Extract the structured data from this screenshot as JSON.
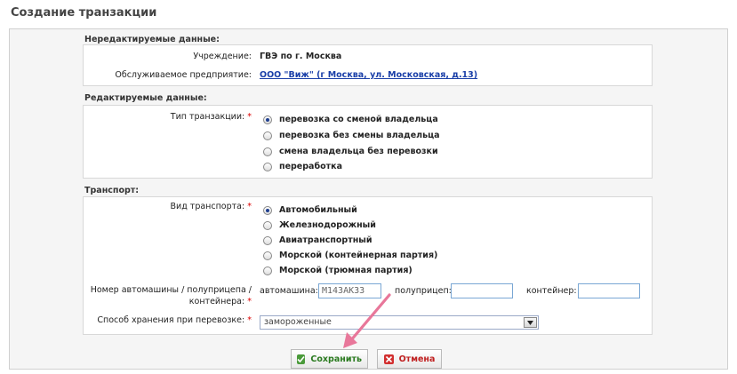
{
  "page": {
    "title": "Создание транзакции"
  },
  "readonly": {
    "section_title": "Нередактируемые данные:",
    "institution_label": "Учреждение:",
    "institution_value": "ГВЭ по г. Москва",
    "enterprise_label": "Обслуживаемое предприятие:",
    "enterprise_value": "ООО \"Виж\" (г Москва, ул. Московская, д.13)"
  },
  "editable": {
    "section_title": "Редактируемые данные:",
    "type_label": "Тип транзакции:",
    "required_mark": "*",
    "type_options": [
      {
        "label": "перевозка со сменой владельца",
        "selected": true
      },
      {
        "label": "перевозка без смены владельца",
        "selected": false
      },
      {
        "label": "смена владельца без перевозки",
        "selected": false
      },
      {
        "label": "переработка",
        "selected": false
      }
    ]
  },
  "transport": {
    "section_title": "Транспорт:",
    "kind_label": "Вид транспорта:",
    "kind_options": [
      {
        "label": "Автомобильный",
        "selected": true
      },
      {
        "label": "Железнодорожный",
        "selected": false
      },
      {
        "label": "Авиатранспортный",
        "selected": false
      },
      {
        "label": "Морской (контейнерная партия)",
        "selected": false
      },
      {
        "label": "Морской (трюмная партия)",
        "selected": false
      }
    ],
    "number_label": "Номер автомашины / полуприцепа / контейнера:",
    "car_label": "автомашина:",
    "car_value": "М143АК33",
    "trailer_label": "полуприцеп:",
    "trailer_value": "",
    "container_label": "контейнер:",
    "container_value": "",
    "storage_label": "Способ хранения при перевозке:",
    "storage_value": "замороженные"
  },
  "actions": {
    "save_label": "Сохранить",
    "cancel_label": "Отмена"
  },
  "colors": {
    "link": "#1a3fa8",
    "save": "#2a7a1f",
    "cancel": "#c02020",
    "annotation_arrow": "#e8779a"
  }
}
